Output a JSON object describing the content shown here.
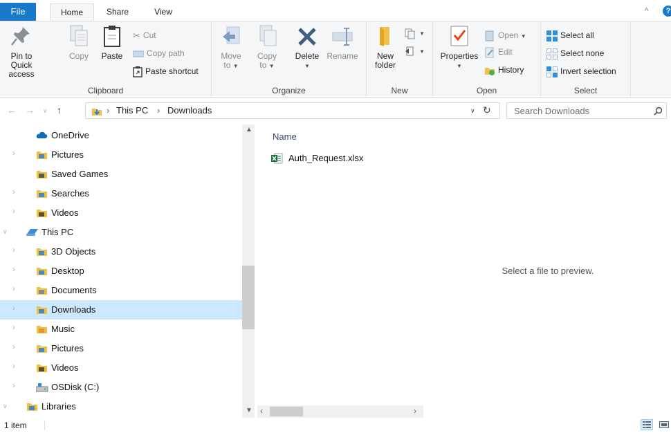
{
  "ribbon_tabs": {
    "file": "File",
    "home": "Home",
    "share": "Share",
    "view": "View"
  },
  "ribbon": {
    "clipboard": {
      "label": "Clipboard",
      "pin_line1": "Pin to Quick",
      "pin_line2": "access",
      "copy": "Copy",
      "paste": "Paste",
      "cut": "Cut",
      "copy_path": "Copy path",
      "paste_shortcut": "Paste shortcut"
    },
    "organize": {
      "label": "Organize",
      "move_line1": "Move",
      "move_line2": "to",
      "copy_line1": "Copy",
      "copy_line2": "to",
      "delete": "Delete",
      "rename": "Rename"
    },
    "new": {
      "label": "New",
      "folder_line1": "New",
      "folder_line2": "folder"
    },
    "open": {
      "label": "Open",
      "properties": "Properties",
      "open": "Open",
      "edit": "Edit",
      "history": "History"
    },
    "select": {
      "label": "Select",
      "select_all": "Select all",
      "select_none": "Select none",
      "invert_selection": "Invert selection"
    }
  },
  "address": {
    "crumbs": [
      "This PC",
      "Downloads"
    ],
    "search_placeholder": "Search Downloads"
  },
  "nav_pane": {
    "items": [
      {
        "label": "OneDrive",
        "icon": "onedrive-cloud-icon",
        "indent": 1,
        "expander": false
      },
      {
        "label": "Pictures",
        "icon": "pictures-folder-icon",
        "indent": 1,
        "expander": true
      },
      {
        "label": "Saved Games",
        "icon": "saved-games-folder-icon",
        "indent": 1,
        "expander": false
      },
      {
        "label": "Searches",
        "icon": "searches-folder-icon",
        "indent": 1,
        "expander": true
      },
      {
        "label": "Videos",
        "icon": "videos-folder-icon",
        "indent": 1,
        "expander": true
      },
      {
        "label": "This PC",
        "icon": "this-pc-icon",
        "indent": 0,
        "expander": true
      },
      {
        "label": "3D Objects",
        "icon": "3d-objects-folder-icon",
        "indent": 1,
        "expander": true
      },
      {
        "label": "Desktop",
        "icon": "desktop-folder-icon",
        "indent": 1,
        "expander": true
      },
      {
        "label": "Documents",
        "icon": "documents-folder-icon",
        "indent": 1,
        "expander": true
      },
      {
        "label": "Downloads",
        "icon": "downloads-folder-icon",
        "indent": 1,
        "expander": true,
        "selected": true
      },
      {
        "label": "Music",
        "icon": "music-folder-icon",
        "indent": 1,
        "expander": true
      },
      {
        "label": "Pictures",
        "icon": "pictures-folder-icon",
        "indent": 1,
        "expander": true
      },
      {
        "label": "Videos",
        "icon": "videos-folder-icon",
        "indent": 1,
        "expander": true
      },
      {
        "label": "OSDisk (C:)",
        "icon": "disk-drive-icon",
        "indent": 1,
        "expander": true
      },
      {
        "label": "Libraries",
        "icon": "libraries-folder-icon",
        "indent": 0,
        "expander": true
      }
    ]
  },
  "content": {
    "column_name": "Name",
    "files": [
      {
        "name": "Auth_Request.xlsx",
        "icon": "excel-file-icon"
      }
    ]
  },
  "preview": {
    "message": "Select a file to preview."
  },
  "status": {
    "item_count": "1 item"
  },
  "colors": {
    "accent": "#1979ca",
    "selection": "#cce8ff",
    "folder": "#f0c040"
  }
}
